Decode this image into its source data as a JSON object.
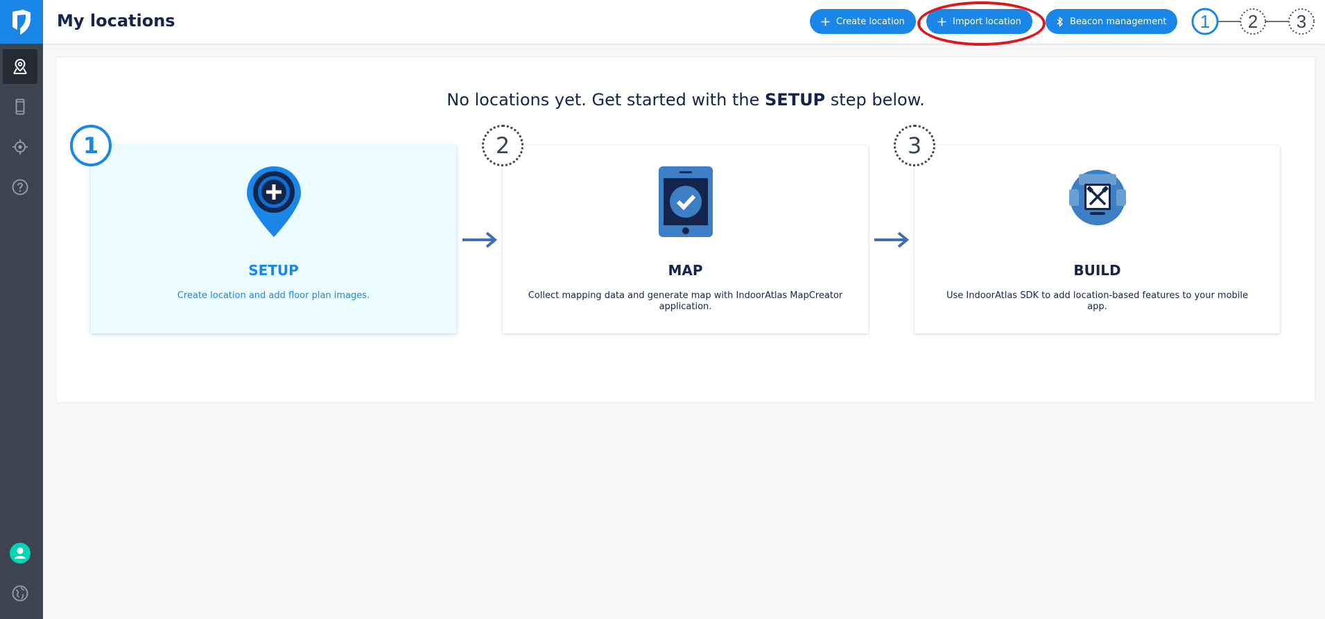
{
  "header": {
    "title": "My locations",
    "buttons": {
      "create": "Create location",
      "import": "Import location",
      "beacon": "Beacon management"
    },
    "steps": [
      "1",
      "2",
      "3"
    ]
  },
  "sidebar": {
    "items": [
      {
        "icon": "location-pin-icon",
        "active": true
      },
      {
        "icon": "phone-icon",
        "active": false
      },
      {
        "icon": "crosshair-icon",
        "active": false
      },
      {
        "icon": "help-icon",
        "active": false
      }
    ],
    "bottom": [
      {
        "icon": "user-avatar-icon"
      },
      {
        "icon": "globe-icon"
      }
    ]
  },
  "main": {
    "headline_prefix": "No locations yet. Get started with the ",
    "headline_bold": "SETUP",
    "headline_suffix": " step below.",
    "cards": [
      {
        "step": "1",
        "title": "SETUP",
        "desc": "Create location and add floor plan images.",
        "icon": "location-plus-icon"
      },
      {
        "step": "2",
        "title": "MAP",
        "desc": "Collect mapping data and generate map with IndoorAtlas MapCreator application.",
        "icon": "tablet-check-icon"
      },
      {
        "step": "3",
        "title": "BUILD",
        "desc": "Use IndoorAtlas SDK to add location-based features to your mobile app.",
        "icon": "build-tools-icon"
      }
    ]
  },
  "colors": {
    "accent": "#1a86e8",
    "sidebar": "#3d4451",
    "text": "#13254a",
    "annotation": "#e0161f"
  }
}
